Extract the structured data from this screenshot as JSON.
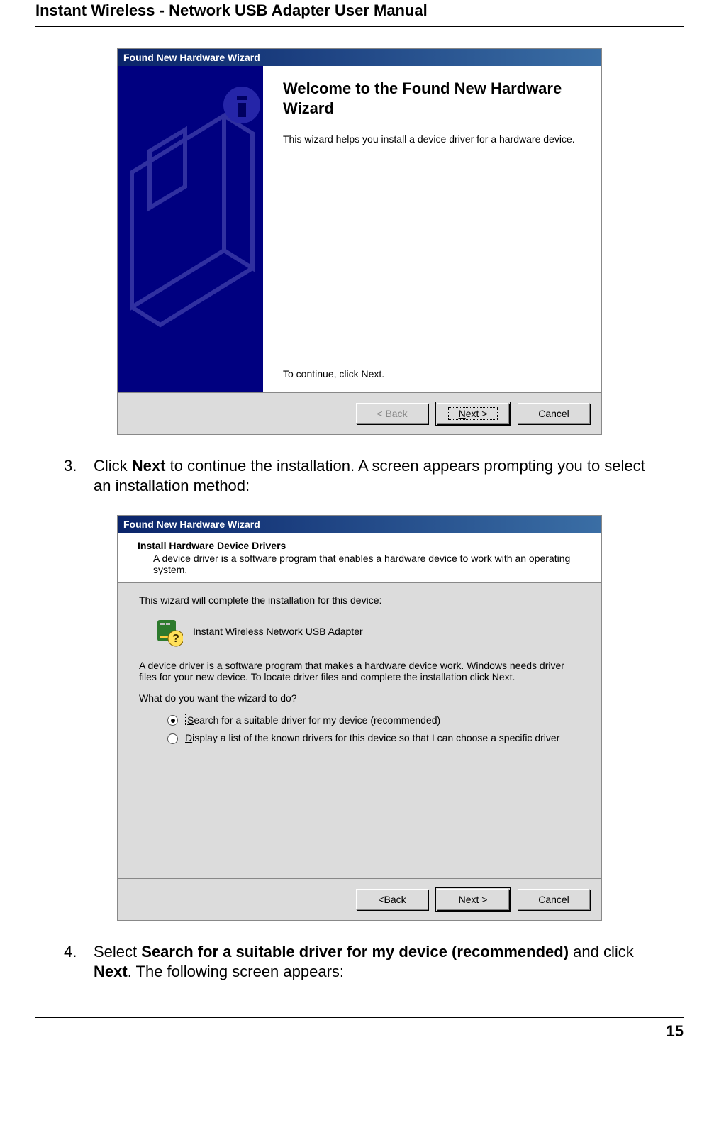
{
  "doc": {
    "header_title": "Instant Wireless - Network USB Adapter User Manual",
    "page_number": "15"
  },
  "step3": {
    "number": "3.",
    "pre": "Click ",
    "bold": "Next",
    "post": " to continue the installation. A screen appears prompting you to select an installation method:"
  },
  "step4": {
    "number": "4.",
    "pre": "Select ",
    "bold1": "Search for a suitable driver for my device (recommended)",
    "mid": " and click ",
    "bold2": "Next",
    "post": ". The following screen appears:"
  },
  "wizard1": {
    "titlebar": "Found New Hardware Wizard",
    "heading": "Welcome to the Found New Hardware Wizard",
    "body": "This wizard helps you install a device driver for a hardware device.",
    "continue": "To continue, click Next.",
    "buttons": {
      "back": "< Back",
      "next": "Next >",
      "cancel": "Cancel"
    }
  },
  "wizard2": {
    "titlebar": "Found New Hardware Wizard",
    "hdr_title": "Install Hardware Device Drivers",
    "hdr_sub": "A device driver is a software program that enables a hardware device to work with an operating system.",
    "line1": "This wizard will complete the installation for this device:",
    "device_name": "Instant Wireless Network USB Adapter",
    "line2": "A device driver is a software program that makes a hardware device work. Windows needs driver files for your new device. To locate driver files and complete the installation click Next.",
    "prompt": "What do you want the wizard to do?",
    "opt1": "Search for a suitable driver for my device (recommended)",
    "opt2": "Display a list of the known drivers for this device so that I can choose a specific driver",
    "buttons": {
      "back": "< Back",
      "next": "Next >",
      "cancel": "Cancel"
    }
  }
}
